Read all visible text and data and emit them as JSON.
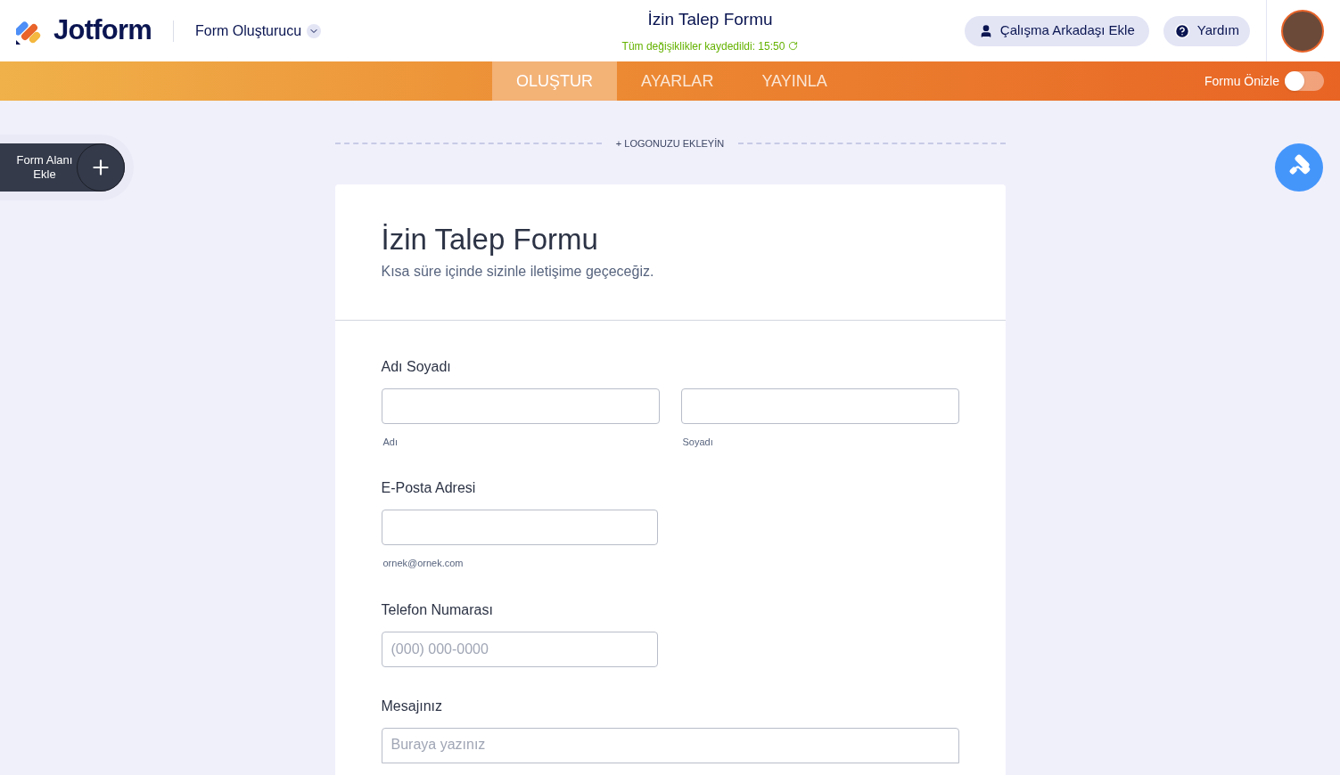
{
  "header": {
    "logo": "Jotform",
    "builder_menu": "Form Oluşturucu",
    "form_title": "İzin Talep Formu",
    "save_status": "Tüm değişiklikler kaydedildi: 15:50",
    "add_collaborator": "Çalışma Arkadaşı Ekle",
    "help": "Yardım"
  },
  "tabs": [
    {
      "label": "OLUŞTUR",
      "selected": true
    },
    {
      "label": "AYARLAR",
      "selected": false
    },
    {
      "label": "YAYINLA",
      "selected": false
    }
  ],
  "preview": {
    "label": "Formu Önizle",
    "on": false
  },
  "add_field": "Form Alanı Ekle",
  "add_logo": "+ LOGONUZU EKLEYİN",
  "form": {
    "title": "İzin Talep Formu",
    "subtitle": "Kısa süre içinde sizinle iletişime geçeceğiz.",
    "fields": [
      {
        "kind": "name",
        "label": "Adı Soyadı",
        "sublabels": [
          "Adı",
          "Soyadı"
        ]
      },
      {
        "kind": "email",
        "label": "E-Posta Adresi",
        "sublabel": "ornek@ornek.com"
      },
      {
        "kind": "phone",
        "label": "Telefon Numarası",
        "placeholder": "(000) 000-0000"
      },
      {
        "kind": "textarea",
        "label": "Mesajınız",
        "placeholder": "Buraya yazınız"
      }
    ]
  }
}
